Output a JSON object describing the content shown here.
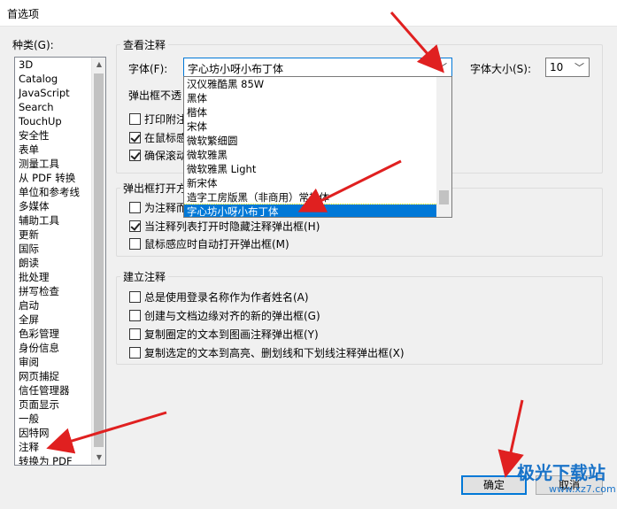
{
  "window": {
    "title": "首选项"
  },
  "categories": {
    "label": "种类(G):",
    "items": [
      "3D",
      "Catalog",
      "JavaScript",
      "Search",
      "TouchUp",
      "安全性",
      "表单",
      "测量工具",
      "从 PDF 转换",
      "单位和参考线",
      "多媒体",
      "辅助工具",
      "更新",
      "国际",
      "朗读",
      "批处理",
      "拼写检查",
      "启动",
      "全屏",
      "色彩管理",
      "身份信息",
      "审阅",
      "网页捕捉",
      "信任管理器",
      "页面显示",
      "一般",
      "因特网",
      "注释",
      "转换为 PDF"
    ],
    "selected": "注释"
  },
  "view_group": {
    "title": "查看注释",
    "font_label": "字体(F):",
    "font_value": "字心坊小呀小布丁体",
    "font_size_label": "字体大小(S):",
    "font_size_value": "10",
    "popup_opacity_label": "弹出框不透",
    "checkboxes": [
      {
        "label": "打印附注",
        "checked": false
      },
      {
        "label": "在鼠标感",
        "checked": true
      },
      {
        "label": "确保滚动",
        "checked": true
      }
    ]
  },
  "font_dropdown": {
    "options": [
      "汉仪雅酷黑 85W",
      "黑体",
      "楷体",
      "宋体",
      "微软繁细圆",
      "微软雅黑",
      "微软雅黑 Light",
      "新宋体",
      "造字工房版黑（非商用）常规体",
      "字心坊小呀小布丁体"
    ],
    "selected": "字心坊小呀小布丁体"
  },
  "popup_group": {
    "title": "弹出框打开方",
    "checkboxes": [
      {
        "label": "为注释而",
        "checked": false
      },
      {
        "label": "当注释列表打开时隐藏注释弹出框(H)",
        "checked": true
      },
      {
        "label": "鼠标感应时自动打开弹出框(M)",
        "checked": false
      }
    ]
  },
  "create_group": {
    "title": "建立注释",
    "checkboxes": [
      {
        "label": "总是使用登录名称作为作者姓名(A)",
        "checked": false
      },
      {
        "label": "创建与文档边缘对齐的新的弹出框(G)",
        "checked": false
      },
      {
        "label": "复制圈定的文本到图画注释弹出框(Y)",
        "checked": false
      },
      {
        "label": "复制选定的文本到高亮、删划线和下划线注释弹出框(X)",
        "checked": false
      }
    ]
  },
  "buttons": {
    "ok": "确定",
    "cancel": "取消"
  },
  "watermark": {
    "text": "极光下载站",
    "url": "www.xz7.com"
  },
  "colors": {
    "accent": "#0078d7",
    "arrow": "#e02020"
  }
}
